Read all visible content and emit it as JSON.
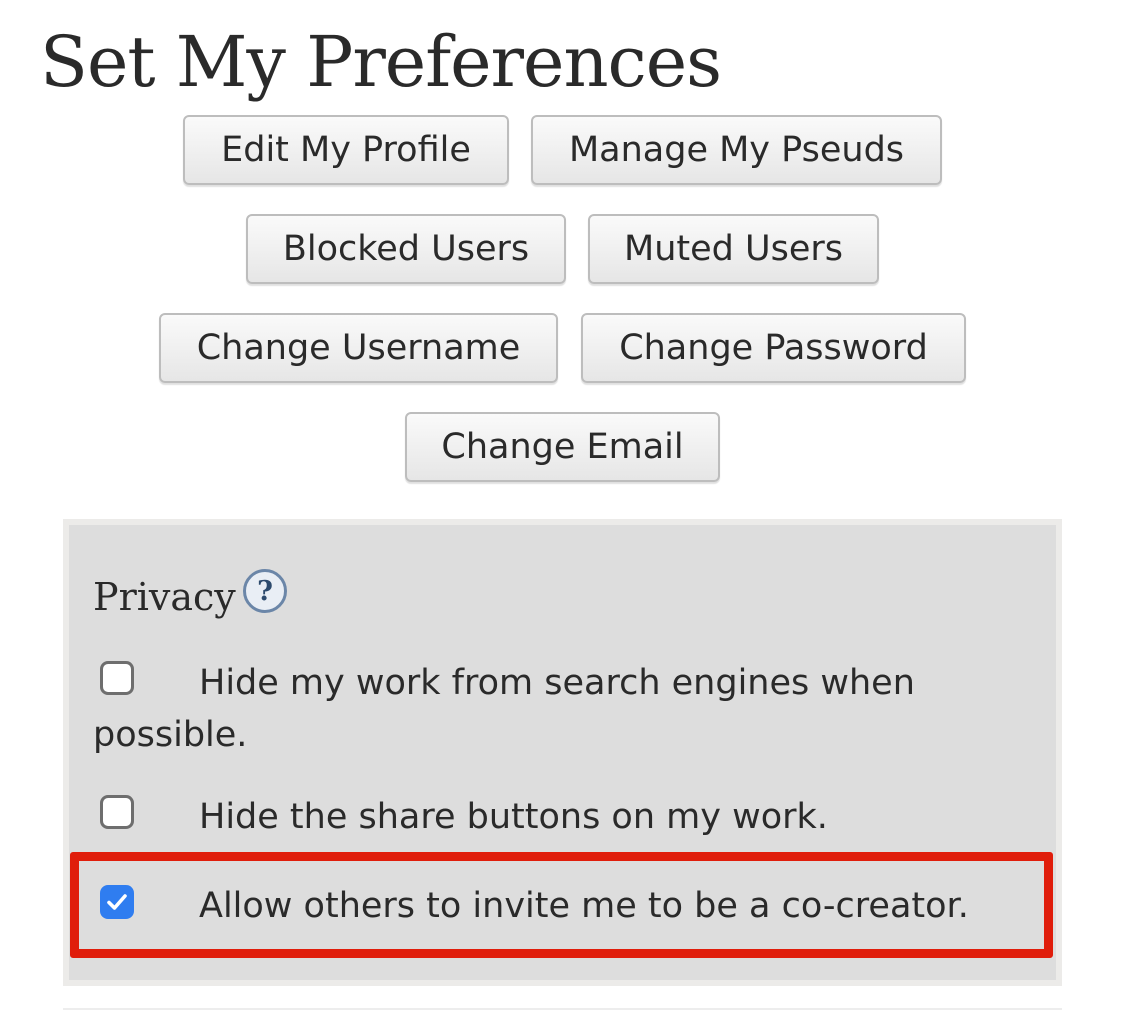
{
  "page": {
    "title": "Set My Preferences"
  },
  "nav_buttons": {
    "edit_profile": "Edit My Profile",
    "manage_pseuds": "Manage My Pseuds",
    "blocked_users": "Blocked Users",
    "muted_users": "Muted Users",
    "change_username": "Change Username",
    "change_password": "Change Password",
    "change_email": "Change Email"
  },
  "privacy": {
    "title": "Privacy",
    "help_icon": "help-question-icon",
    "help_glyph": "?",
    "options": [
      {
        "label_line1": "Hide my work from search engines when",
        "label_line2": "possible.",
        "checked": false
      },
      {
        "label": "Hide the share buttons on my work.",
        "checked": false
      },
      {
        "label": "Allow others to invite me to be a co-creator.",
        "checked": true,
        "highlighted": true
      }
    ]
  },
  "colors": {
    "highlight_border": "#e01d0b",
    "checkbox_checked": "#2f7df0",
    "panel_background": "#dddddd"
  }
}
